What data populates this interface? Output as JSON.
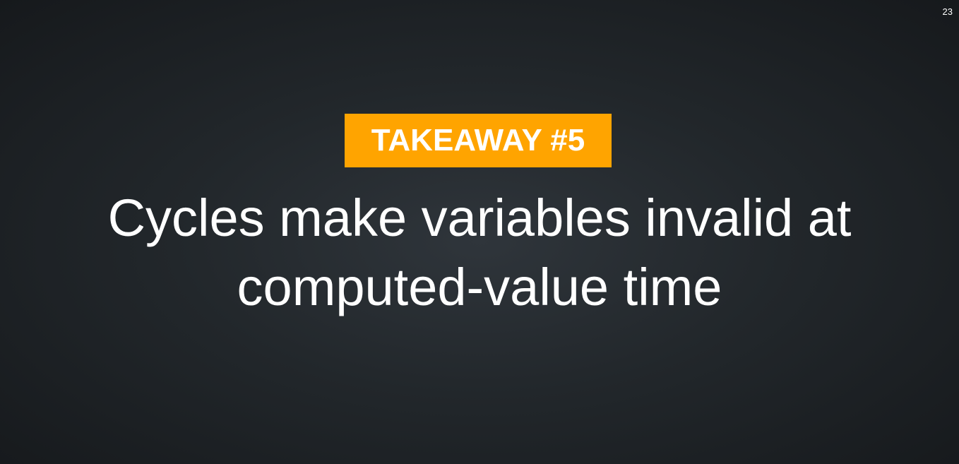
{
  "slide": {
    "number": "23",
    "badge": "TAKEAWAY #5",
    "headline_lines": [
      "Cycles make variables invalid at",
      "computed-value time"
    ]
  },
  "colors": {
    "badge_background": "#ffa400",
    "text": "#ffffff",
    "background": "#22272b"
  }
}
